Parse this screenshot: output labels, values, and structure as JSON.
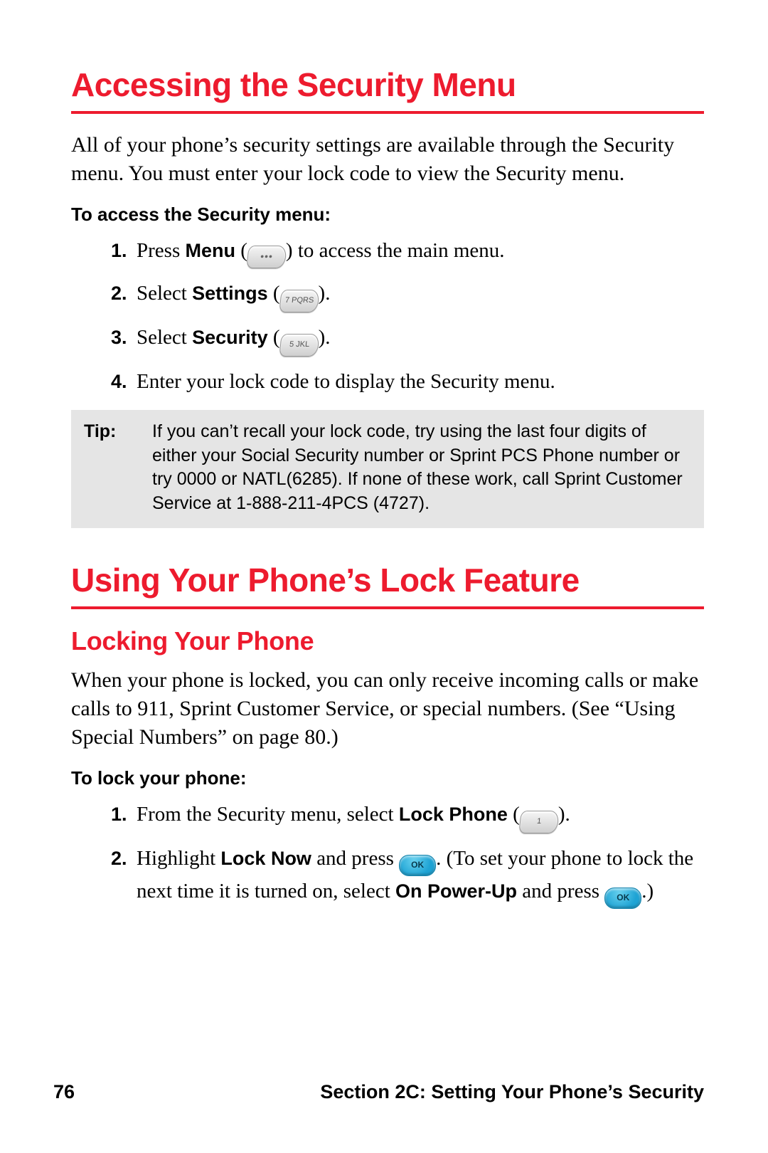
{
  "heading1": "Accessing the Security Menu",
  "intro1": "All of your phone’s security settings are available through the Security menu. You must enter your lock code to view the Security menu.",
  "task1": "To access the Security menu:",
  "steps1": {
    "s1a": "Press ",
    "s1b": "Menu",
    "s1c": " (",
    "s1d": ") to access the main menu.",
    "s2a": "Select ",
    "s2b": "Settings",
    "s2c": " (",
    "s2key": "7 PQRS",
    "s2d": ").",
    "s3a": "Select ",
    "s3b": "Security",
    "s3c": " (",
    "s3key": "5 JKL",
    "s3d": ").",
    "s4": "Enter your lock code to display the Security menu."
  },
  "tip": {
    "label": "Tip:",
    "body": "If you can’t recall your lock code, try using the last four digits of either your Social Security number or Sprint PCS Phone number or try 0000 or NATL(6285). If none of these work, call Sprint Customer Service at 1-888-211-4PCS (4727)."
  },
  "heading2": "Using Your Phone’s Lock Feature",
  "subheading2": "Locking Your Phone",
  "intro2": "When your phone is locked, you can only receive incoming calls or make calls to 911, Sprint Customer Service, or special numbers. (See “Using Special Numbers” on page 80.)",
  "task2": "To lock your phone:",
  "steps2": {
    "s1a": "From the Security menu, select ",
    "s1b": "Lock Phone",
    "s1c": " (",
    "s1key": "1",
    "s1d": ").",
    "s2a": "Highlight ",
    "s2b": "Lock Now",
    "s2c": " and press ",
    "s2ok": "OK",
    "s2d": ". (To set your phone to lock the next time it is turned on, select ",
    "s2e": "On Power-Up",
    "s2f": " and press ",
    "s2g": ".)"
  },
  "footer": {
    "page": "76",
    "title": "Section 2C: Setting Your Phone’s Security"
  }
}
